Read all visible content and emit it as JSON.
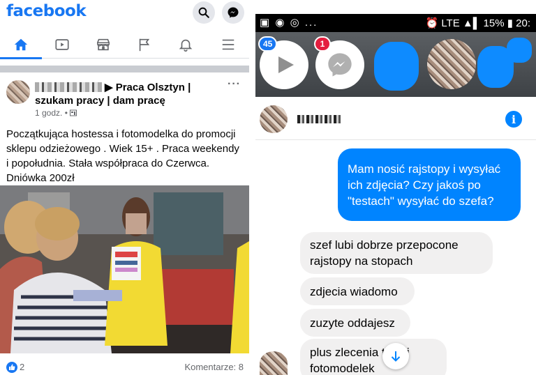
{
  "facebook": {
    "logo": "facebook",
    "brand_color": "#1877f2",
    "header_icons": [
      "search-icon",
      "messenger-icon"
    ],
    "nav": [
      {
        "name": "home",
        "icon": "home-icon",
        "active": true
      },
      {
        "name": "watch",
        "icon": "video-icon",
        "active": false
      },
      {
        "name": "marketplace",
        "icon": "store-icon",
        "active": false
      },
      {
        "name": "pages",
        "icon": "flag-icon",
        "active": false
      },
      {
        "name": "notifications",
        "icon": "bell-icon",
        "active": false
      },
      {
        "name": "menu",
        "icon": "hamburger-icon",
        "active": false
      }
    ],
    "post": {
      "group": "▶ Praca Olsztyn | szukam pracy | dam pracę",
      "time": "1 godz. • ",
      "more": "···",
      "text": "Początkująca hostessa i fotomodelka do promocji sklepu odzieżowego . Wiek 15+ . Praca weekendy i popołudnia. Stała współpraca do Czerwca. Dniówka 200zł",
      "likes": "2",
      "comments": "Komentarze: 8"
    }
  },
  "messenger": {
    "status": {
      "left": "▣ ◉ ◎ ...",
      "right": "⏰ LTE ▲▌ 15% ▮ 20:"
    },
    "chatheads": [
      {
        "badge": "45",
        "icon": "play-icon",
        "badge_color": "#1877f2"
      },
      {
        "badge": "1",
        "icon": "messenger-icon",
        "badge_color": "#e41e3f"
      }
    ],
    "accent": "#0084ff",
    "info_label": "i",
    "messages": [
      {
        "side": "out",
        "text": "Mam nosić rajstopy i wysyłać ich zdjęcia? Czy jakoś po \"testach\" wysyłać do szefa?"
      },
      {
        "side": "in",
        "text": "szef lubi dobrze przepocone rajstopy na stopach"
      },
      {
        "side": "in",
        "text": "zdjecia wiadomo"
      },
      {
        "side": "in",
        "text": "zuzyte oddajesz"
      },
      {
        "side": "in",
        "text": "plus zlecenia   tess i fotomodelek"
      }
    ]
  }
}
